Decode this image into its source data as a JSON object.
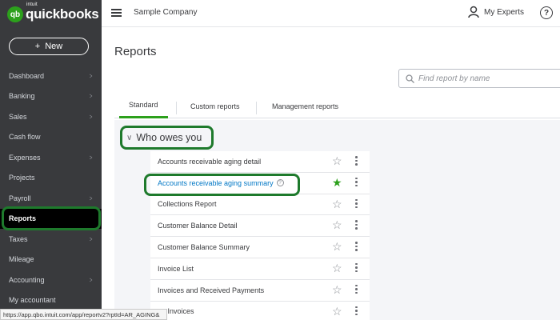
{
  "brand": {
    "badge": "qb",
    "intuit": "intuit",
    "name": "quickbooks",
    "accent": "#2ca01c",
    "highlight": "#1e7a2c"
  },
  "sidebar": {
    "new_label": "New",
    "new_icon": "+",
    "items": [
      {
        "label": "Dashboard",
        "chevron": true
      },
      {
        "label": "Banking",
        "chevron": true
      },
      {
        "label": "Sales",
        "chevron": true
      },
      {
        "label": "Cash flow",
        "chevron": false
      },
      {
        "label": "Expenses",
        "chevron": true
      },
      {
        "label": "Projects",
        "chevron": false
      },
      {
        "label": "Payroll",
        "chevron": true
      },
      {
        "label": "Reports",
        "chevron": false,
        "active": true
      },
      {
        "label": "Taxes",
        "chevron": true
      },
      {
        "label": "Mileage",
        "chevron": false
      },
      {
        "label": "Accounting",
        "chevron": true
      },
      {
        "label": "My accountant",
        "chevron": false
      }
    ]
  },
  "topbar": {
    "company": "Sample Company",
    "experts": "My Experts",
    "help": "?"
  },
  "page": {
    "title": "Reports"
  },
  "search": {
    "placeholder": "Find report by name"
  },
  "tabs": [
    "Standard",
    "Custom reports",
    "Management reports"
  ],
  "section": {
    "title": "Who owes you"
  },
  "reports": [
    {
      "label": "Accounts receivable aging detail",
      "starred": false,
      "link": false,
      "info": false
    },
    {
      "label": "Accounts receivable aging summary",
      "starred": true,
      "link": true,
      "info": true
    },
    {
      "label": "Collections Report",
      "starred": false,
      "link": false,
      "info": false
    },
    {
      "label": "Customer Balance Detail",
      "starred": false,
      "link": false,
      "info": false
    },
    {
      "label": "Customer Balance Summary",
      "starred": false,
      "link": false,
      "info": false
    },
    {
      "label": "Invoice List",
      "starred": false,
      "link": false,
      "info": false
    },
    {
      "label": "Invoices and Received Payments",
      "starred": false,
      "link": false,
      "info": false
    },
    {
      "label": "en Invoices",
      "starred": false,
      "link": false,
      "info": false
    }
  ],
  "status_url": "https://app.qbo.intuit.com/app/reportv2?rptId=AR_AGING&"
}
